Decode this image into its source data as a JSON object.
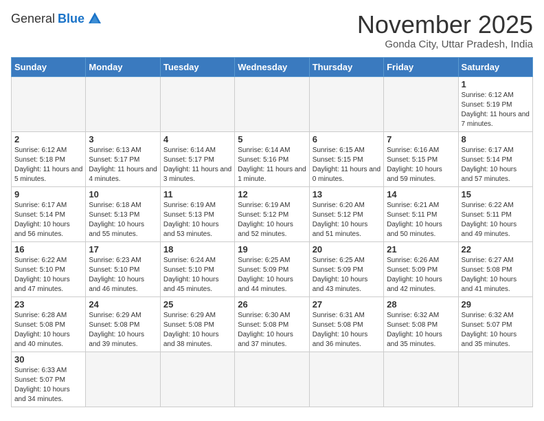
{
  "logo": {
    "general": "General",
    "blue": "Blue"
  },
  "title": {
    "month": "November 2025",
    "location": "Gonda City, Uttar Pradesh, India"
  },
  "headers": [
    "Sunday",
    "Monday",
    "Tuesday",
    "Wednesday",
    "Thursday",
    "Friday",
    "Saturday"
  ],
  "weeks": [
    [
      {
        "day": "",
        "info": ""
      },
      {
        "day": "",
        "info": ""
      },
      {
        "day": "",
        "info": ""
      },
      {
        "day": "",
        "info": ""
      },
      {
        "day": "",
        "info": ""
      },
      {
        "day": "",
        "info": ""
      },
      {
        "day": "1",
        "info": "Sunrise: 6:12 AM\nSunset: 5:19 PM\nDaylight: 11 hours and 7 minutes."
      }
    ],
    [
      {
        "day": "2",
        "info": "Sunrise: 6:12 AM\nSunset: 5:18 PM\nDaylight: 11 hours and 5 minutes."
      },
      {
        "day": "3",
        "info": "Sunrise: 6:13 AM\nSunset: 5:17 PM\nDaylight: 11 hours and 4 minutes."
      },
      {
        "day": "4",
        "info": "Sunrise: 6:14 AM\nSunset: 5:17 PM\nDaylight: 11 hours and 3 minutes."
      },
      {
        "day": "5",
        "info": "Sunrise: 6:14 AM\nSunset: 5:16 PM\nDaylight: 11 hours and 1 minute."
      },
      {
        "day": "6",
        "info": "Sunrise: 6:15 AM\nSunset: 5:15 PM\nDaylight: 11 hours and 0 minutes."
      },
      {
        "day": "7",
        "info": "Sunrise: 6:16 AM\nSunset: 5:15 PM\nDaylight: 10 hours and 59 minutes."
      },
      {
        "day": "8",
        "info": "Sunrise: 6:17 AM\nSunset: 5:14 PM\nDaylight: 10 hours and 57 minutes."
      }
    ],
    [
      {
        "day": "9",
        "info": "Sunrise: 6:17 AM\nSunset: 5:14 PM\nDaylight: 10 hours and 56 minutes."
      },
      {
        "day": "10",
        "info": "Sunrise: 6:18 AM\nSunset: 5:13 PM\nDaylight: 10 hours and 55 minutes."
      },
      {
        "day": "11",
        "info": "Sunrise: 6:19 AM\nSunset: 5:13 PM\nDaylight: 10 hours and 53 minutes."
      },
      {
        "day": "12",
        "info": "Sunrise: 6:19 AM\nSunset: 5:12 PM\nDaylight: 10 hours and 52 minutes."
      },
      {
        "day": "13",
        "info": "Sunrise: 6:20 AM\nSunset: 5:12 PM\nDaylight: 10 hours and 51 minutes."
      },
      {
        "day": "14",
        "info": "Sunrise: 6:21 AM\nSunset: 5:11 PM\nDaylight: 10 hours and 50 minutes."
      },
      {
        "day": "15",
        "info": "Sunrise: 6:22 AM\nSunset: 5:11 PM\nDaylight: 10 hours and 49 minutes."
      }
    ],
    [
      {
        "day": "16",
        "info": "Sunrise: 6:22 AM\nSunset: 5:10 PM\nDaylight: 10 hours and 47 minutes."
      },
      {
        "day": "17",
        "info": "Sunrise: 6:23 AM\nSunset: 5:10 PM\nDaylight: 10 hours and 46 minutes."
      },
      {
        "day": "18",
        "info": "Sunrise: 6:24 AM\nSunset: 5:10 PM\nDaylight: 10 hours and 45 minutes."
      },
      {
        "day": "19",
        "info": "Sunrise: 6:25 AM\nSunset: 5:09 PM\nDaylight: 10 hours and 44 minutes."
      },
      {
        "day": "20",
        "info": "Sunrise: 6:25 AM\nSunset: 5:09 PM\nDaylight: 10 hours and 43 minutes."
      },
      {
        "day": "21",
        "info": "Sunrise: 6:26 AM\nSunset: 5:09 PM\nDaylight: 10 hours and 42 minutes."
      },
      {
        "day": "22",
        "info": "Sunrise: 6:27 AM\nSunset: 5:08 PM\nDaylight: 10 hours and 41 minutes."
      }
    ],
    [
      {
        "day": "23",
        "info": "Sunrise: 6:28 AM\nSunset: 5:08 PM\nDaylight: 10 hours and 40 minutes."
      },
      {
        "day": "24",
        "info": "Sunrise: 6:29 AM\nSunset: 5:08 PM\nDaylight: 10 hours and 39 minutes."
      },
      {
        "day": "25",
        "info": "Sunrise: 6:29 AM\nSunset: 5:08 PM\nDaylight: 10 hours and 38 minutes."
      },
      {
        "day": "26",
        "info": "Sunrise: 6:30 AM\nSunset: 5:08 PM\nDaylight: 10 hours and 37 minutes."
      },
      {
        "day": "27",
        "info": "Sunrise: 6:31 AM\nSunset: 5:08 PM\nDaylight: 10 hours and 36 minutes."
      },
      {
        "day": "28",
        "info": "Sunrise: 6:32 AM\nSunset: 5:08 PM\nDaylight: 10 hours and 35 minutes."
      },
      {
        "day": "29",
        "info": "Sunrise: 6:32 AM\nSunset: 5:07 PM\nDaylight: 10 hours and 35 minutes."
      }
    ],
    [
      {
        "day": "30",
        "info": "Sunrise: 6:33 AM\nSunset: 5:07 PM\nDaylight: 10 hours and 34 minutes."
      },
      {
        "day": "",
        "info": ""
      },
      {
        "day": "",
        "info": ""
      },
      {
        "day": "",
        "info": ""
      },
      {
        "day": "",
        "info": ""
      },
      {
        "day": "",
        "info": ""
      },
      {
        "day": "",
        "info": ""
      }
    ]
  ]
}
